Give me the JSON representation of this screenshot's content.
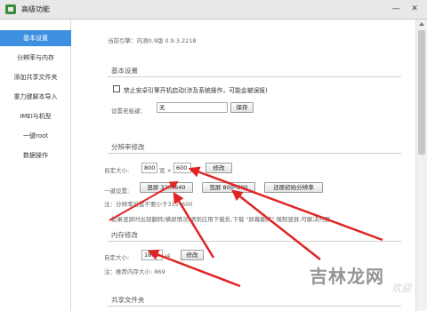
{
  "window": {
    "title": "高级功能",
    "minimize_symbol": "—",
    "close_symbol": "✕"
  },
  "sidebar": {
    "items": [
      {
        "label": "基本设置",
        "active": true
      },
      {
        "label": "分辨率与内存",
        "active": false
      },
      {
        "label": "添加共享文件夹",
        "active": false
      },
      {
        "label": "重力键脚本导入",
        "active": false
      },
      {
        "label": "IMEI与机型",
        "active": false
      },
      {
        "label": "一键root",
        "active": false
      },
      {
        "label": "数据操作",
        "active": false
      }
    ]
  },
  "main": {
    "engine_info": "当前引擎：内测0.9版 0.9.3.2218",
    "basic": {
      "title": "基本设置",
      "checkbox_label": "禁止安卓引擎开机启动(涉及系统操作，可能会被误报)",
      "checkbox_checked": false,
      "boss_key_label": "设置老板键：",
      "boss_key_value": "无",
      "save_label": "保存"
    },
    "resolution": {
      "title": "分辨率修改",
      "custom_label": "自定大小:",
      "width": "800",
      "times": "宽 ×",
      "height": "600",
      "modify_label": "修改",
      "quick_label": "一键设置:",
      "portrait_label": "竖屏  320*640",
      "landscape_label": "宽屏  800*600",
      "restore_label": "还原初始分辨率",
      "note": "注：分辨率设置不要小于315*600",
      "hint": "如果竖屏时出现翻转/横屏情况,请到应用下载处,下载 \"屏幕翻转\" 强制竖屏,可解决问题"
    },
    "memory": {
      "title": "内存修改",
      "custom_label": "自定大小:",
      "value": "1863",
      "value_suffix": "/4",
      "modify_label": "修改",
      "note": "注：推荐内存大小: 869"
    },
    "share": {
      "title": "共享文件夹"
    }
  },
  "watermark": {
    "text": "吉林龙网",
    "sub": "欢迎"
  },
  "colors": {
    "accent": "#3d8fe0",
    "arrow": "#e02424",
    "titlebar": "#e8e8e8"
  }
}
